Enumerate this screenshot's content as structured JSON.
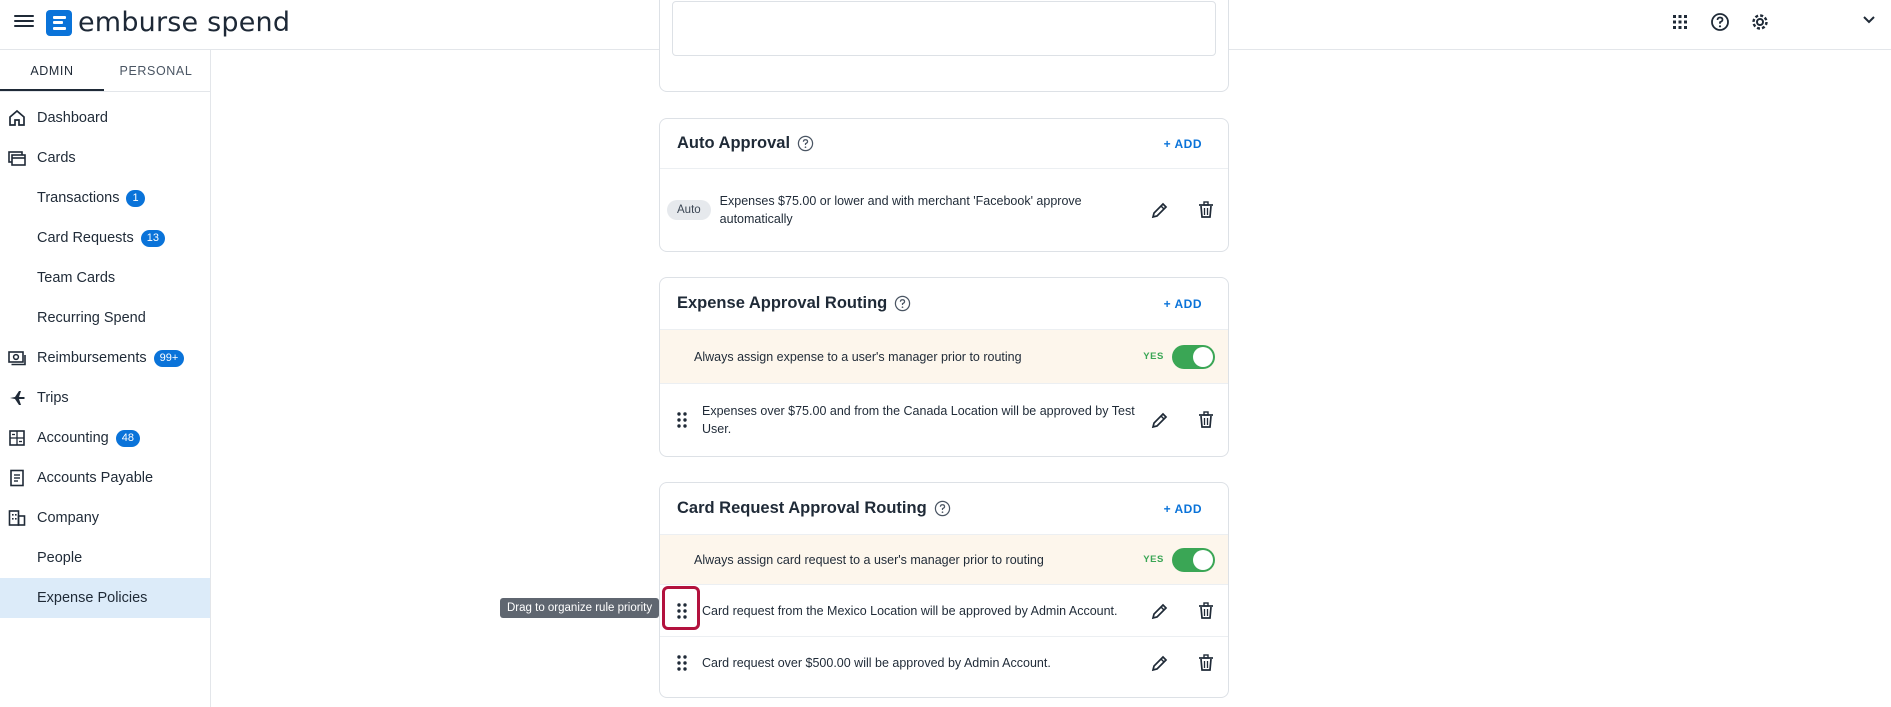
{
  "app": {
    "brand": "emburse spend"
  },
  "sidebar": {
    "tabs": [
      {
        "label": "ADMIN"
      },
      {
        "label": "PERSONAL"
      }
    ],
    "items": [
      {
        "label": "Dashboard",
        "icon": "home-icon"
      },
      {
        "label": "Cards",
        "icon": "cards-icon"
      },
      {
        "label": "Transactions",
        "badge": "1"
      },
      {
        "label": "Card Requests",
        "badge": "13"
      },
      {
        "label": "Team Cards"
      },
      {
        "label": "Recurring Spend"
      },
      {
        "label": "Reimbursements",
        "badge": "99+",
        "icon": "cash-icon"
      },
      {
        "label": "Trips",
        "icon": "plane-icon"
      },
      {
        "label": "Accounting",
        "badge": "48",
        "icon": "calculator-icon"
      },
      {
        "label": "Accounts Payable",
        "icon": "invoice-icon"
      },
      {
        "label": "Company",
        "icon": "building-icon"
      },
      {
        "label": "People"
      },
      {
        "label": "Expense Policies",
        "active": true
      }
    ]
  },
  "auto_approval": {
    "title": "Auto Approval",
    "add_label": "+ ADD",
    "rules": [
      {
        "tag": "Auto",
        "text": "Expenses $75.00 or lower and with merchant 'Facebook' approve automatically"
      }
    ]
  },
  "expense_routing": {
    "title": "Expense Approval Routing",
    "add_label": "+ ADD",
    "toggle_text": "Always assign expense to a user's manager prior to routing",
    "toggle_state": "YES",
    "rules": [
      {
        "text": "Expenses over $75.00 and from the Canada Location will be approved by Test User."
      }
    ]
  },
  "card_routing": {
    "title": "Card Request Approval Routing",
    "add_label": "+ ADD",
    "toggle_text": "Always assign card request to a user's manager prior to routing",
    "toggle_state": "YES",
    "rules": [
      {
        "text": "Card request from the Mexico Location will be approved by Admin Account."
      },
      {
        "text": "Card request over $500.00 will be approved by Admin Account."
      }
    ]
  },
  "tooltip": {
    "text": "Drag to organize rule priority"
  },
  "colors": {
    "accent": "#0a73d9",
    "toggle_on": "#3aa655",
    "highlight": "#b3123e"
  }
}
